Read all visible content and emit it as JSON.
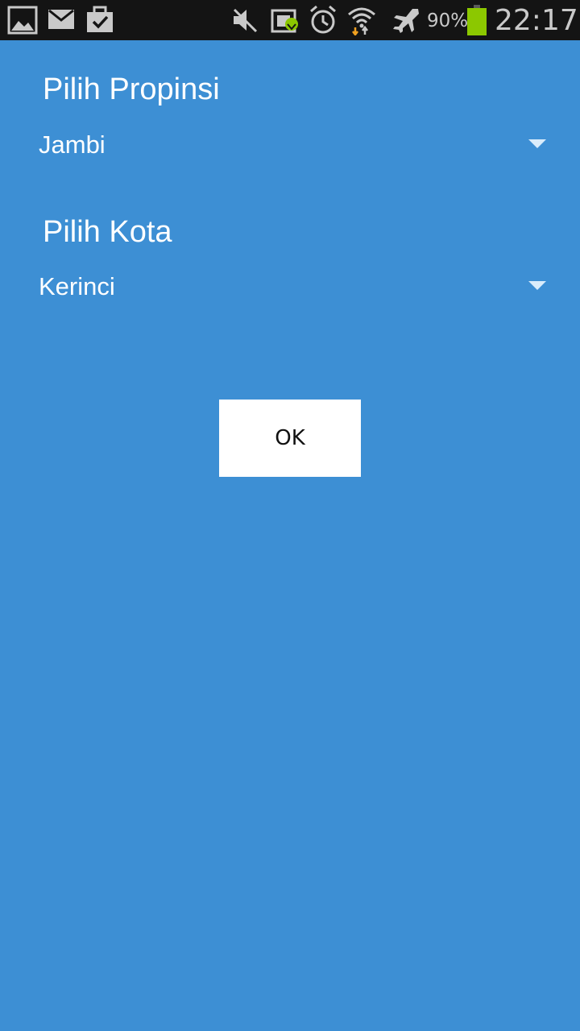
{
  "status_bar": {
    "left_icons": [
      "gallery-icon",
      "email-icon",
      "clipboard-check-icon"
    ],
    "right_icons": [
      "mute-icon",
      "app-update-icon",
      "alarm-icon",
      "wifi-icon",
      "airplane-mode-icon",
      "battery-icon"
    ],
    "battery_percent": "90%",
    "time": "22:17",
    "battery_color": "#8cc800"
  },
  "form": {
    "province_label": "Pilih Propinsi",
    "province_value": "Jambi",
    "city_label": "Pilih Kota",
    "city_value": "Kerinci",
    "ok_label": "OK"
  },
  "colors": {
    "background": "#3d8fd4",
    "status_bar": "#141414",
    "button": "#ffffff"
  }
}
